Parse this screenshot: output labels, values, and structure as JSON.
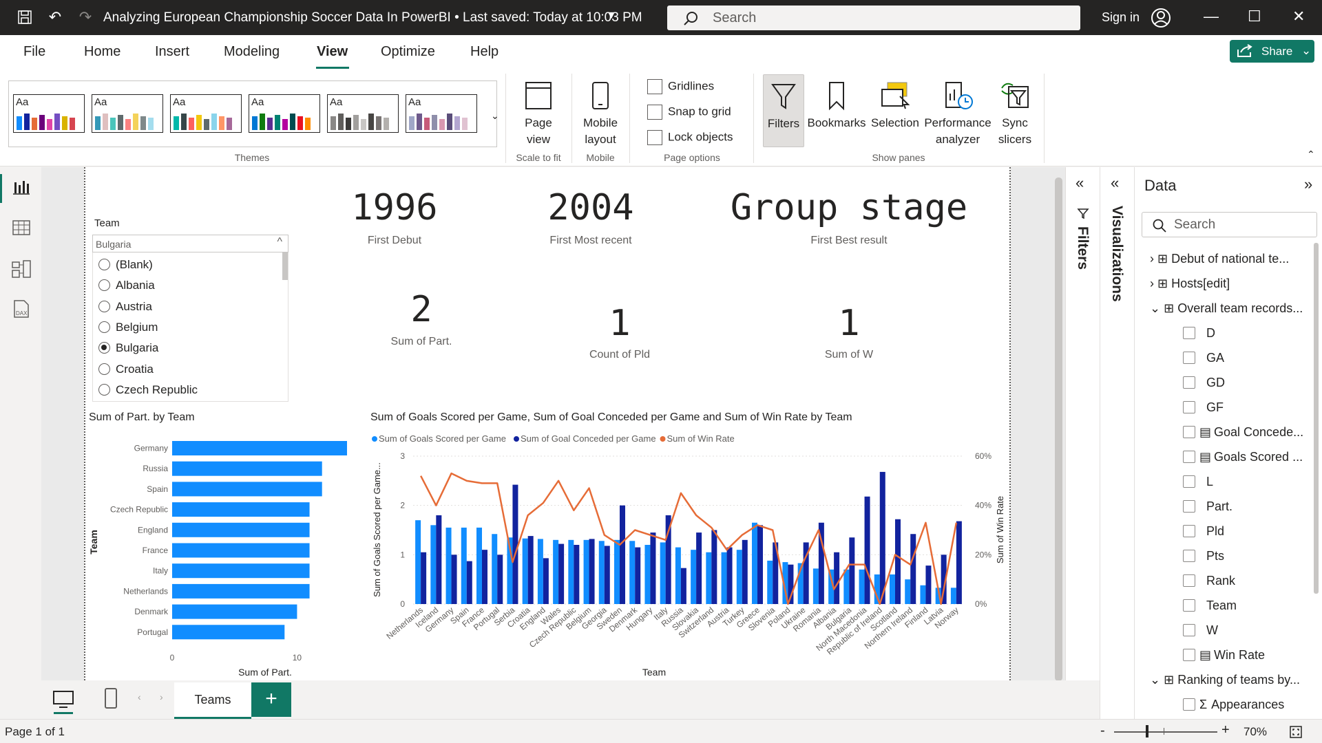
{
  "titlebar": {
    "title": "Analyzing European Championship Soccer Data In PowerBI • Last saved: Today at 10:03 PM",
    "search_placeholder": "Search",
    "sign_in": "Sign in"
  },
  "menu": {
    "items": [
      "File",
      "Home",
      "Insert",
      "Modeling",
      "View",
      "Optimize",
      "Help"
    ],
    "active": "View",
    "share": "Share"
  },
  "ribbon": {
    "themes_label": "Themes",
    "theme_sample": "Aa",
    "page_view": "Page view",
    "scale_label": "Scale to fit",
    "mobile_layout": "Mobile layout",
    "mobile_label": "Mobile",
    "gridlines": "Gridlines",
    "snap": "Snap to grid",
    "lock": "Lock objects",
    "page_options_label": "Page options",
    "filters": "Filters",
    "bookmarks": "Bookmarks",
    "selection": "Selection",
    "performance": "Performance analyzer",
    "sync": "Sync slicers",
    "show_panes_label": "Show panes"
  },
  "slicer": {
    "title": "Team",
    "selected": "Bulgaria",
    "items": [
      "(Blank)",
      "Albania",
      "Austria",
      "Belgium",
      "Bulgaria",
      "Croatia",
      "Czech Republic"
    ]
  },
  "cards": [
    {
      "value": "1996",
      "label": "First Debut"
    },
    {
      "value": "2004",
      "label": "First Most recent"
    },
    {
      "value": "Group stage",
      "label": "First Best result"
    },
    {
      "value": "2",
      "label": "Sum of Part."
    },
    {
      "value": "1",
      "label": "Count of Pld"
    },
    {
      "value": "1",
      "label": "Sum of W"
    }
  ],
  "chart_data": [
    {
      "type": "bar",
      "title": "Sum of Part. by Team",
      "orientation": "horizontal",
      "categories": [
        "Germany",
        "Russia",
        "Spain",
        "Czech Republic",
        "England",
        "France",
        "Italy",
        "Netherlands",
        "Denmark",
        "Portugal"
      ],
      "values": [
        14,
        12,
        12,
        11,
        11,
        11,
        11,
        11,
        10,
        9
      ],
      "xlabel": "Sum of Part.",
      "ylabel": "Team",
      "xlim": [
        0,
        14
      ],
      "xticks": [
        "0",
        "10"
      ],
      "color": "#118dff"
    },
    {
      "type": "bar",
      "title": "Sum of Goals Scored per Game, Sum of Goal Conceded per Game and Sum of Win Rate by Team",
      "categories": [
        "Netherlands",
        "Iceland",
        "Germany",
        "Spain",
        "France",
        "Portugal",
        "Serbia",
        "Croatia",
        "England",
        "Wales",
        "Czech Republic",
        "Belgium",
        "Georgia",
        "Sweden",
        "Denmark",
        "Hungary",
        "Italy",
        "Russia",
        "Slovakia",
        "Switzerland",
        "Austria",
        "Turkey",
        "Greece",
        "Slovenia",
        "Poland",
        "Ukraine",
        "Romania",
        "Albania",
        "Bulgaria",
        "North Macedonia",
        "Republic of Ireland",
        "Scotland",
        "Northern Ireland",
        "Finland",
        "Latvia",
        "Norway"
      ],
      "series": [
        {
          "name": "Sum of Goals Scored per Game",
          "color": "#118dff",
          "axis": "left",
          "values": [
            1.7,
            1.6,
            1.55,
            1.55,
            1.55,
            1.42,
            1.35,
            1.33,
            1.32,
            1.3,
            1.3,
            1.3,
            1.28,
            1.3,
            1.28,
            1.2,
            1.25,
            1.15,
            1.1,
            1.05,
            1.05,
            1.1,
            1.65,
            0.88,
            0.85,
            0.83,
            0.72,
            0.7,
            0.7,
            0.7,
            0.6,
            0.6,
            0.5,
            0.38,
            0.33,
            0.33
          ]
        },
        {
          "name": "Sum of Goal Conceded per Game",
          "color": "#12239e",
          "axis": "left",
          "values": [
            1.05,
            1.8,
            1.0,
            0.87,
            1.1,
            1.0,
            2.42,
            1.38,
            0.93,
            1.22,
            1.2,
            1.32,
            1.18,
            2.0,
            1.15,
            1.45,
            1.8,
            0.73,
            1.45,
            1.5,
            1.15,
            1.3,
            1.6,
            1.25,
            0.8,
            1.25,
            1.65,
            1.05,
            1.35,
            2.18,
            2.68,
            1.72,
            1.42,
            0.78,
            1.0,
            1.68
          ]
        },
        {
          "name": "Sum of Win Rate",
          "color": "#e66c37",
          "axis": "right",
          "values": [
            52,
            40,
            53,
            50,
            49,
            49,
            17,
            36,
            41,
            50,
            38,
            47,
            28,
            24,
            30,
            28,
            26,
            45,
            36,
            31,
            22,
            28,
            32,
            30,
            0,
            17,
            30,
            6,
            16,
            16,
            0,
            20,
            16,
            33,
            0,
            33
          ]
        }
      ],
      "xlabel": "Team",
      "ylabel": "Sum of Goals Scored per Game...",
      "y2label": "Sum of Win Rate",
      "ylim": [
        0,
        3
      ],
      "yticks": [
        "0",
        "1",
        "2",
        "3"
      ],
      "y2lim": [
        0,
        60
      ],
      "y2ticks": [
        "0%",
        "20%",
        "40%",
        "60%"
      ],
      "legend": "top-left"
    }
  ],
  "tabs": {
    "active": "Teams"
  },
  "status": {
    "page": "Page 1 of 1",
    "zoom": "70%"
  },
  "panes": {
    "filters": "Filters",
    "visualizations": "Visualizations"
  },
  "data_pane": {
    "title": "Data",
    "search_placeholder": "Search",
    "tables": [
      "Debut of national te...",
      "Hosts[edit]",
      "Overall team records...",
      "Ranking of teams by..."
    ],
    "fields": [
      "D",
      "GA",
      "GD",
      "GF",
      "Goal Concede...",
      "Goals Scored ...",
      "L",
      "Part.",
      "Pld",
      "Pts",
      "Rank",
      "Team",
      "W",
      "Win Rate",
      "Appearances"
    ]
  },
  "colors": {
    "accent": "#117865",
    "bar_light": "#118dff",
    "bar_dark": "#12239e",
    "line": "#e66c37"
  }
}
